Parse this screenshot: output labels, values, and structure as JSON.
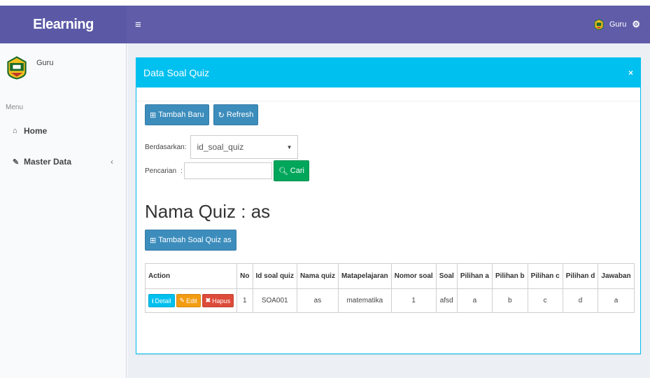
{
  "brand": "Elearning",
  "topbar": {
    "menu_icon": "hamburger-icon",
    "user": "Guru",
    "settings_icon": "gears-icon"
  },
  "sidebar": {
    "user_name": "Guru",
    "menu_header": "Menu",
    "items": [
      {
        "label": "Home",
        "icon": "home-icon"
      },
      {
        "label": "Master Data",
        "icon": "edit-icon",
        "chevron": "‹"
      }
    ]
  },
  "box": {
    "title": "Data Soal Quiz",
    "close": "×",
    "toolbar": {
      "add_label": "Tambah Baru",
      "refresh_label": "Refresh"
    },
    "filter": {
      "label": "Berdasarkan:",
      "selected": "id_soal_quiz"
    },
    "search": {
      "label": "Pencarian",
      "separator": ":",
      "value": "",
      "button_label": "Cari"
    },
    "quiz_title": "Nama Quiz : as",
    "add_question_label": "Tambah Soal Quiz as"
  },
  "table": {
    "headers": [
      "Action",
      "No",
      "Id soal quiz",
      "Nama quiz",
      "Matapelajaran",
      "Nomor soal",
      "Soal",
      "Pilihan a",
      "Pilihan b",
      "Pilihan c",
      "Pilihan d",
      "Jawaban"
    ],
    "rows": [
      {
        "no": "1",
        "id": "SOA001",
        "nama": "as",
        "mapel": "matematika",
        "nomor": "1",
        "soal": "afsd",
        "a": "a",
        "b": "b",
        "c": "c",
        "d": "d",
        "jawaban": "a"
      }
    ],
    "action_labels": {
      "detail": "Detail",
      "edit": "Edit",
      "hapus": "Hapus"
    }
  },
  "colors": {
    "brand": "#5b59a6",
    "topbar": "#605ca8",
    "info": "#00c0ef",
    "primary": "#3c8dbc",
    "success": "#00a65a",
    "warning": "#f39c12",
    "danger": "#dd4b39"
  }
}
